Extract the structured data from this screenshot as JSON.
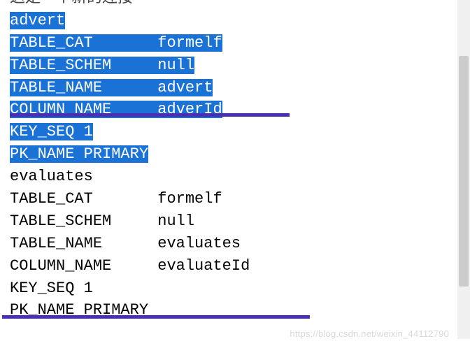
{
  "truncated_top": "这是一个新的连接",
  "section1": {
    "header": "advert",
    "table_cat_k": "TABLE_CAT",
    "table_cat_v": "formelf",
    "table_schem_k": "TABLE_SCHEM",
    "table_schem_v": "null",
    "table_name_k": "TABLE_NAME",
    "table_name_v": "advert",
    "column_name_k": "COLUMN_NAME",
    "column_name_v": "adverId",
    "key_seq": "KEY_SEQ 1",
    "pk_name": "PK_NAME PRIMARY"
  },
  "section2": {
    "header": "evaluates",
    "table_cat_k": "TABLE_CAT",
    "table_cat_v": "formelf",
    "table_schem_k": "TABLE_SCHEM",
    "table_schem_v": "null",
    "table_name_k": "TABLE_NAME",
    "table_name_v": "evaluates",
    "column_name_k": "COLUMN_NAME",
    "column_name_v": "evaluateId",
    "key_seq": "KEY_SEQ 1",
    "pk_name": "PK_NAME PRIMARY"
  },
  "watermark": "https://blog.csdn.net/weixin_44112790"
}
